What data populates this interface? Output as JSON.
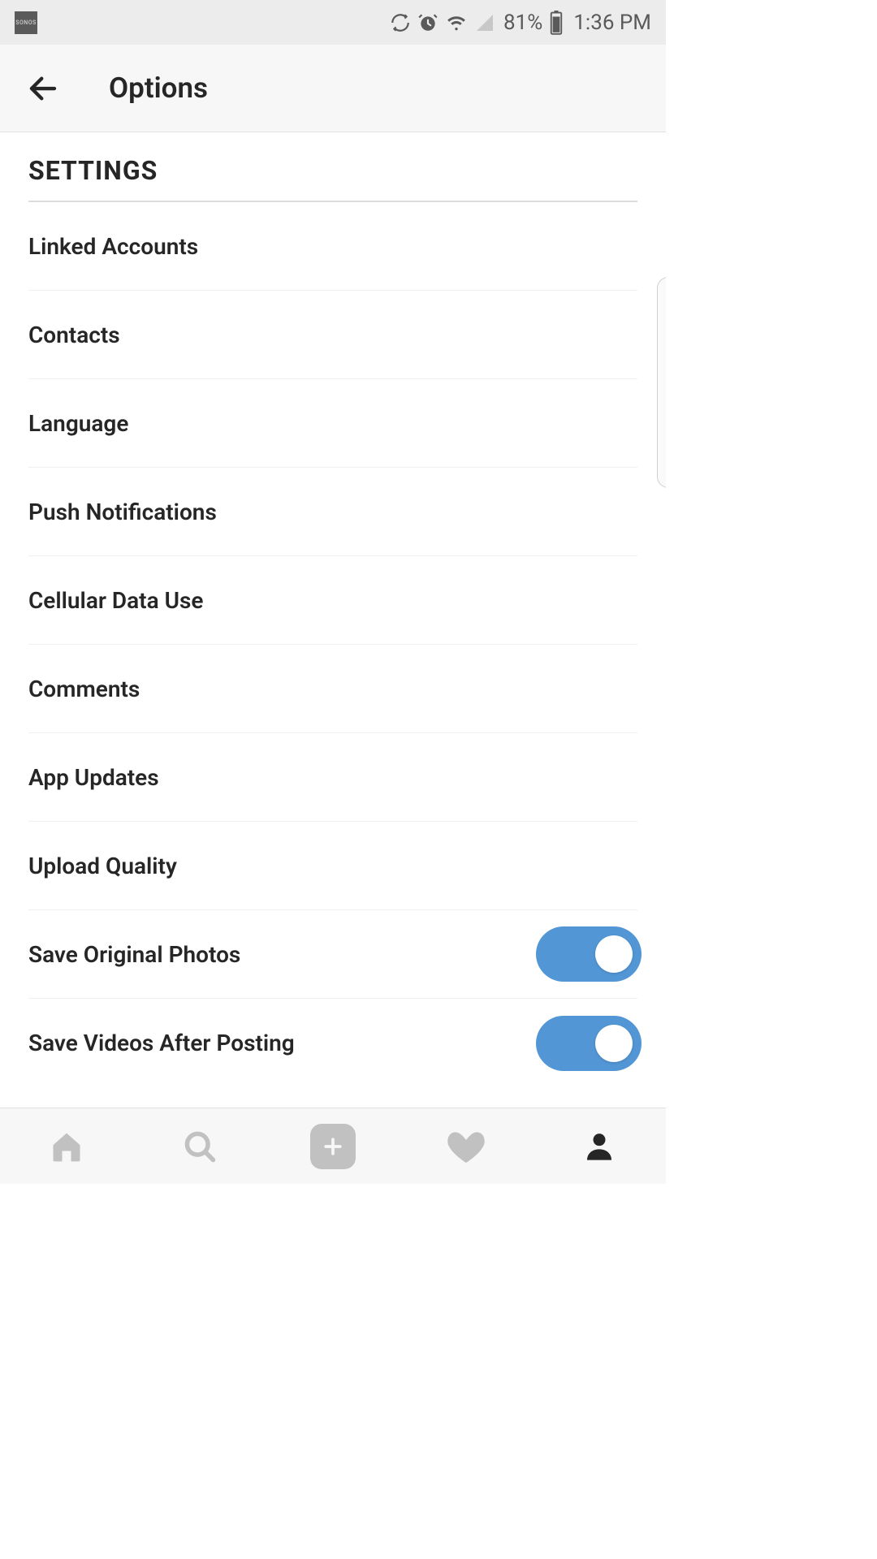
{
  "status": {
    "app_badge": "SONOS",
    "battery_percent": "81%",
    "time": "1:36 PM"
  },
  "header": {
    "title": "Options"
  },
  "section_title": "SETTINGS",
  "rows": [
    {
      "label": "Linked Accounts",
      "toggle": null
    },
    {
      "label": "Contacts",
      "toggle": null
    },
    {
      "label": "Language",
      "toggle": null
    },
    {
      "label": "Push Notifications",
      "toggle": null
    },
    {
      "label": "Cellular Data Use",
      "toggle": null
    },
    {
      "label": "Comments",
      "toggle": null
    },
    {
      "label": "App Updates",
      "toggle": null
    },
    {
      "label": "Upload Quality",
      "toggle": null
    },
    {
      "label": "Save Original Photos",
      "toggle": true
    },
    {
      "label": "Save Videos After Posting",
      "toggle": true
    }
  ],
  "nav": {
    "active": "profile"
  },
  "colors": {
    "toggle_on": "#5296d5",
    "inactive_icon": "#c1c1c1",
    "active_icon": "#262626"
  }
}
